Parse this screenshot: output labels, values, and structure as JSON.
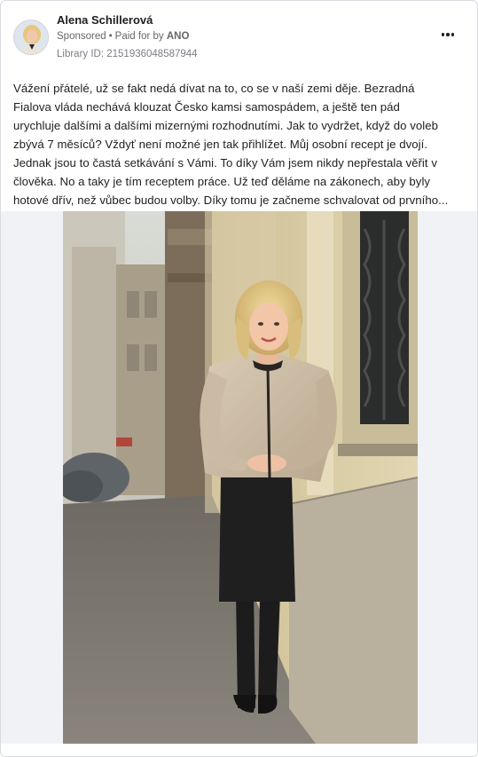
{
  "post": {
    "advertiser_name": "Alena Schillerová",
    "sponsored_label": "Sponsored",
    "separator": "•",
    "paid_for_by_label": "Paid for by",
    "payer": "ANO",
    "library_id": "Library ID: 2151936048587944",
    "more_icon": "more-horizontal-icon",
    "text_lines": [
      "Vážení přátelé, už se fakt nedá dívat na to, co se v naší zemi děje. Bezradná",
      "Fialova vláda nechává klouzat Česko kamsi samospádem, a ještě ten pád",
      "urychluje dalšími a dalšími mizernými rozhodnutími. Jak to vydržet, když do voleb",
      "zbývá 7 měsíců? Vždyť není možné jen tak přihlížet. Můj osobní recept je dvojí.",
      "Jednak jsou to častá setkávání s Vámi. To díky Vám jsem nikdy nepřestala věřit v",
      "člověka. No a taky je tím receptem práce. Už teď děláme na zákonech, aby byly",
      "hotové dřív, než vůbec budou volby. Díky tomu je začneme schvalovat od prvního..."
    ]
  },
  "colors": {
    "text_primary": "#1c1e21",
    "text_secondary": "#65676b",
    "border": "#d9dbe0",
    "media_background": "#f0f2f5"
  }
}
